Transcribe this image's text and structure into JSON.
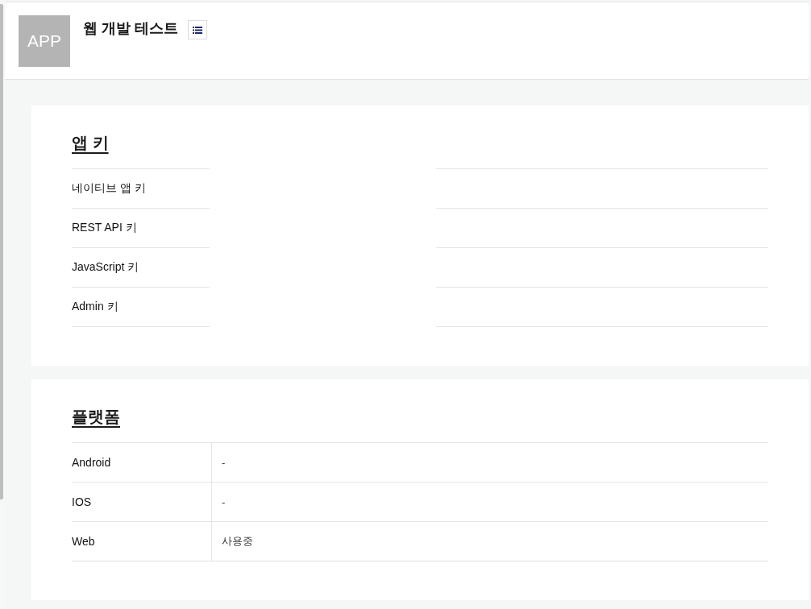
{
  "header": {
    "app_icon": "APP",
    "title": "웹 개발 테스트"
  },
  "app_keys": {
    "heading": "앱 키",
    "rows": [
      {
        "label": "네이티브 앱 키"
      },
      {
        "label": "REST API 키"
      },
      {
        "label": "JavaScript 키"
      },
      {
        "label": "Admin 키"
      }
    ]
  },
  "platforms": {
    "heading": "플랫폼",
    "rows": [
      {
        "name": "Android",
        "status": "-"
      },
      {
        "name": "IOS",
        "status": "-"
      },
      {
        "name": "Web",
        "status": "사용중"
      }
    ]
  }
}
